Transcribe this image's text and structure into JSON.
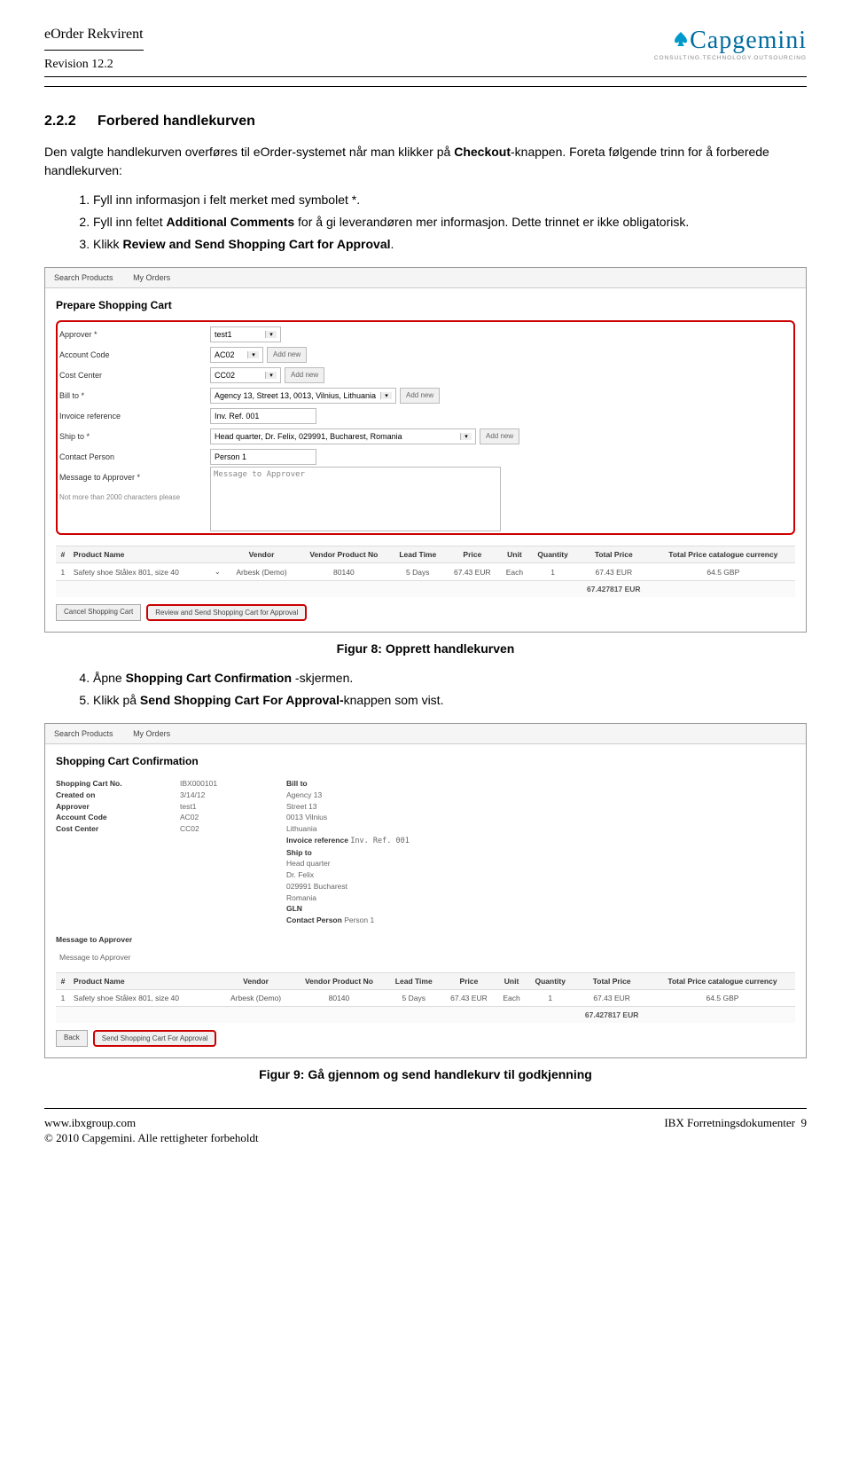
{
  "header": {
    "title": "eOrder Rekvirent",
    "revision": "Revision 12.2",
    "logo_text": "Capgemini",
    "logo_sub": "CONSULTING.TECHNOLOGY.OUTSOURCING"
  },
  "section": {
    "number": "2.2.2",
    "title": "Forbered handlekurven",
    "intro1": "Den valgte handlekurven overføres til eOrder-systemet når man klikker på ",
    "intro1_bold": "Checkout",
    "intro1_after": "-knappen. Foreta følgende trinn for å forberede handlekurven:",
    "steps123": [
      {
        "pre": "Fyll inn informasjon i felt merket med symbolet *.",
        "bold": "",
        "after": ""
      },
      {
        "pre": "Fyll inn feltet ",
        "bold": "Additional Comments",
        "after": " for å gi leverandøren mer informasjon. Dette trinnet er ikke obligatorisk."
      },
      {
        "pre": "Klikk ",
        "bold": "Review and Send Shopping Cart for Approval",
        "after": "."
      }
    ],
    "caption1": "Figur 8: Opprett handlekurven",
    "step4_pre": "Åpne ",
    "step4_bold": "Shopping Cart Confirmation ",
    "step4_after": "-skjermen.",
    "step5_pre": "Klikk på ",
    "step5_bold": "Send Shopping Cart For Approval-",
    "step5_after": "knappen som vist.",
    "caption2": "Figur 9: Gå gjennom og send handlekurv til godkjenning"
  },
  "ss1": {
    "tab1": "Search Products",
    "tab2": "My Orders",
    "title": "Prepare Shopping Cart",
    "labels": {
      "approver": "Approver *",
      "account": "Account Code",
      "cost": "Cost Center",
      "bill": "Bill to *",
      "invoice": "Invoice reference",
      "ship": "Ship to *",
      "contact": "Contact Person",
      "msg": "Message to Approver *",
      "msg_sub": "Not more than 2000 characters please"
    },
    "fields": {
      "approver": "test1",
      "account": "AC02",
      "cost": "CC02",
      "bill": "Agency 13, Street 13, 0013, Vilnius, Lithuania",
      "invoice": "Inv. Ref. 001",
      "ship": "Head quarter, Dr. Felix, 029991, Bucharest, Romania",
      "contact": "Person 1",
      "msg": "Message to Approver",
      "addnew": "Add new"
    },
    "table": {
      "headers": [
        "#",
        "Product Name",
        "",
        "Vendor",
        "Vendor Product No",
        "Lead Time",
        "Price",
        "Unit",
        "Quantity",
        "Total Price",
        "Total Price catalogue currency"
      ],
      "row": [
        "1",
        "Safety shoe Stålex 801, size 40",
        "⌄",
        "Arbesk (Demo)",
        "80140",
        "5 Days",
        "67.43 EUR",
        "Each",
        "1",
        "67.43 EUR",
        "64.5 GBP"
      ],
      "total": "67.427817 EUR"
    },
    "btn_cancel": "Cancel Shopping Cart",
    "btn_review": "Review and Send Shopping Cart for Approval"
  },
  "ss2": {
    "tab1": "Search Products",
    "tab2": "My Orders",
    "title": "Shopping Cart Confirmation",
    "left_labels": [
      "Shopping Cart No.",
      "Created on",
      "Approver",
      "Account Code",
      "Cost Center"
    ],
    "left_vals": [
      "IBX000101",
      "3/14/12",
      "test1",
      "AC02",
      "CC02"
    ],
    "bill_label": "Bill to",
    "bill_lines": [
      "Agency 13",
      "Street 13",
      "0013  Vilnius",
      "Lithuania"
    ],
    "invref_label": "Invoice reference",
    "invref_val": "Inv. Ref. 001",
    "ship_label": "Ship to",
    "ship_lines": [
      "Head quarter",
      "Dr. Felix",
      "029991  Bucharest",
      "Romania"
    ],
    "gln_label": "GLN",
    "contact_label": "Contact Person",
    "contact_val": "Person 1",
    "msg_label": "Message to Approver",
    "msg_val": "Message to Approver",
    "table": {
      "headers": [
        "#",
        "Product Name",
        "",
        "Vendor",
        "Vendor Product No",
        "Lead Time",
        "Price",
        "Unit",
        "Quantity",
        "Total Price",
        "Total Price catalogue currency"
      ],
      "row": [
        "1",
        "Safety shoe Stålex 801, size 40",
        "",
        "Arbesk (Demo)",
        "80140",
        "5 Days",
        "67.43 EUR",
        "Each",
        "1",
        "67.43 EUR",
        "64.5 GBP"
      ],
      "total": "67.427817 EUR"
    },
    "btn_back": "Back",
    "btn_send": "Send Shopping Cart For Approval"
  },
  "footer": {
    "url": "www.ibxgroup.com",
    "copyright": "© 2010 Capgemini. Alle rettigheter forbeholdt",
    "right": "IBX Forretningsdokumenter",
    "page": "9"
  }
}
